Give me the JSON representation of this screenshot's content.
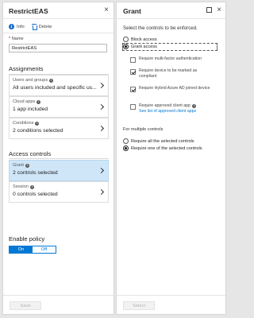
{
  "policy_pane": {
    "title": "RestrictEAS",
    "close": "×",
    "toolbar": {
      "info_label": "Info",
      "delete_label": "Delete"
    },
    "name_field": {
      "required_mark": "*",
      "label": "Name",
      "value": "RestrictEAS"
    },
    "assignments": {
      "heading": "Assignments",
      "users": {
        "label": "Users and groups",
        "value": "All users included and specific us..."
      },
      "cloud_apps": {
        "label": "Cloud apps",
        "value": "1 app included"
      },
      "conditions": {
        "label": "Conditions",
        "value": "2 conditions selected"
      }
    },
    "access_controls": {
      "heading": "Access controls",
      "grant": {
        "label": "Grant",
        "value": "2 controls selected"
      },
      "session": {
        "label": "Session",
        "value": "0 controls selected"
      }
    },
    "enable_policy": {
      "heading": "Enable policy",
      "on": "On",
      "off": "Off",
      "selected": "On"
    },
    "save_label": "Save"
  },
  "grant_pane": {
    "title": "Grant",
    "close": "×",
    "instruction": "Select the controls to be enforced.",
    "block_access": "Block access",
    "grant_access": "Grant access",
    "controls": [
      {
        "label": "Require multi-factor authentication",
        "checked": false
      },
      {
        "label_line1": "Require device to be marked as",
        "label_line2": "compliant",
        "checked": true
      },
      {
        "label": "Require Hybrid Azure AD joined device",
        "checked": true
      },
      {
        "label": "Require approved client app",
        "link": "See list of approved client apps",
        "checked": false
      }
    ],
    "multiple_heading": "For multiple controls",
    "require_all": "Require all the selected controls",
    "require_one": "Require one of the selected controls",
    "select_label": "Select"
  },
  "colors": {
    "accent": "#0078d4",
    "selected_row": "#cfe6f8",
    "info_icon": "#1a6fc9"
  },
  "icons": [
    "info-icon",
    "trash-icon",
    "close-icon",
    "maximize-icon",
    "chevron-right-icon"
  ]
}
